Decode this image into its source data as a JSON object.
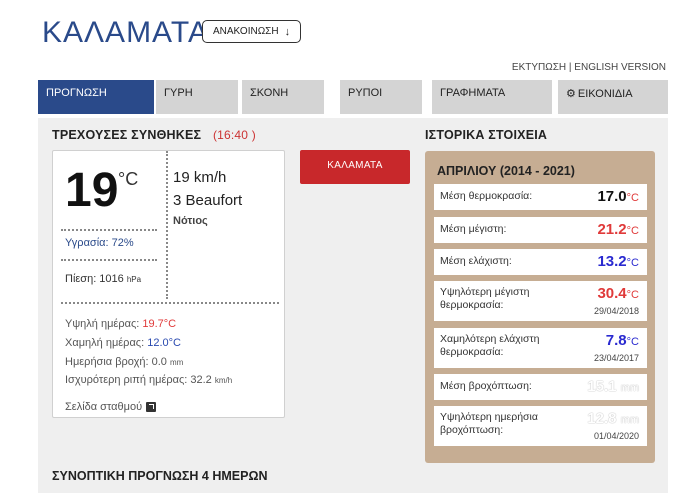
{
  "header": {
    "city": "ΚΑΛΑΜΑΤΑ",
    "announce_label": "ΑΝΑΚΟΙΝΩΣΗ",
    "announce_icon": "arrow-down-icon",
    "print_link": "ΕΚΤΥΠΩΣΗ",
    "separator": "|",
    "english_link": "ENGLISH VERSION"
  },
  "tabs": [
    {
      "label": "ΠΡΟΓΝΩΣΗ",
      "active": true
    },
    {
      "label": "ΓΥΡΗ",
      "active": false
    },
    {
      "label": "ΣΚΟΝΗ",
      "active": false
    },
    {
      "label": "ΡΥΠΟΙ",
      "active": false
    },
    {
      "label": "ΓΡΑΦΗΜΑΤΑ",
      "active": false
    },
    {
      "label": "ΕΙΚΟΝΙΔΙΑ",
      "active": false,
      "icon": "gear-icon"
    }
  ],
  "current": {
    "title": "ΤΡΕΧΟΥΣΕΣ ΣΥΝΘΗΚΕΣ",
    "time": "(16:40 )",
    "temperature": "19",
    "temp_unit": "°C",
    "wind_speed": "19 km/h",
    "wind_beaufort": "3 Beaufort",
    "wind_direction": "Νότιος",
    "humidity": "Υγρασία: 72%",
    "pressure_label": "Πίεση: 1016",
    "pressure_unit": "hPa",
    "high_label": "Υψηλή ημέρας:",
    "high_value": "19.7°C",
    "low_label": "Χαμηλή ημέρας:",
    "low_value": "12.0°C",
    "rain_label": "Ημερήσια βροχή: 0.0",
    "rain_unit": "mm",
    "gust_label": "Ισχυρότερη ριπή ημέρας: 32.2",
    "gust_unit": "km/h",
    "station_link": "Σελίδα σταθμού"
  },
  "city_button": "ΚΑΛΑΜΑΤΑ",
  "history": {
    "section_title": "ΙΣΤΟΡΙΚΑ ΣΤΟΙΧΕΙΑ",
    "period": "ΑΠΡΙΛΙΟΥ (2014 - 2021)",
    "rows": [
      {
        "label": "Μέση θερμοκρασία:",
        "value": "17.0",
        "unit": "°C",
        "date": "",
        "color": "#111111"
      },
      {
        "label": "Μέση μέγιστη:",
        "value": "21.2",
        "unit": "°C",
        "date": "",
        "color": "#e03a3a"
      },
      {
        "label": "Μέση ελάχιστη:",
        "value": "13.2",
        "unit": "°C",
        "date": "",
        "color": "#2a2ad0"
      },
      {
        "label": "Υψηλότερη μέγιστη θερμοκρασία:",
        "value": "30.4",
        "unit": "°C",
        "date": "29/04/2018",
        "color": "#e03a3a"
      },
      {
        "label": "Χαμηλότερη ελάχιστη θερμοκρασία:",
        "value": "7.8",
        "unit": "°C",
        "date": "23/04/2017",
        "color": "#2a2ad0"
      },
      {
        "label": "Μέση βροχόπτωση:",
        "value": "15.1",
        "unit": "mm",
        "date": "",
        "color": "#ffffff"
      },
      {
        "label": "Υψηλότερη ημερήσια βροχόπτωση:",
        "value": "12.8",
        "unit": "mm",
        "date": "01/04/2020",
        "color": "#ffffff"
      }
    ]
  },
  "synoptic_title": "ΣΥΝΟΠΤΙΚΗ ΠΡΟΓΝΩΣΗ 4 ΗΜΕΡΩΝ"
}
